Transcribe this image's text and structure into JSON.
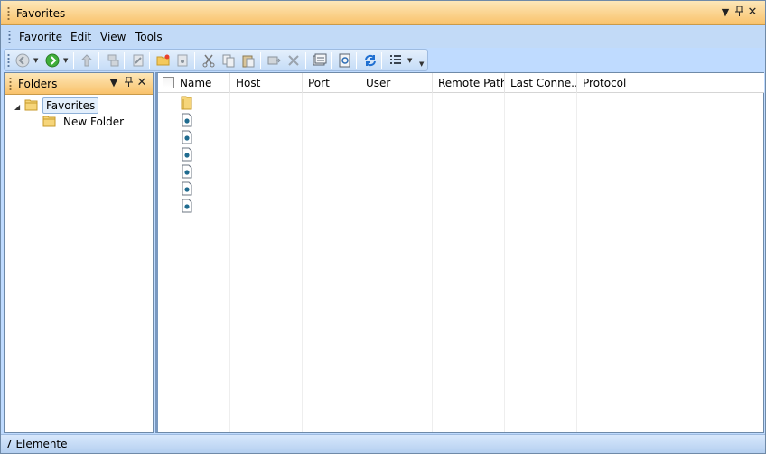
{
  "window": {
    "title": "Favorites"
  },
  "menu": {
    "items": [
      {
        "label": "Favorite",
        "accel": "F",
        "rest": "avorite"
      },
      {
        "label": "Edit",
        "accel": "E",
        "rest": "dit"
      },
      {
        "label": "View",
        "accel": "V",
        "rest": "iew"
      },
      {
        "label": "Tools",
        "accel": "T",
        "rest": "ools"
      }
    ]
  },
  "toolbar": {
    "icons": [
      "back-icon",
      "forward-icon",
      "up-folder-icon",
      "connect-icon",
      "edit-icon",
      "new-folder-icon",
      "new-favorite-icon",
      "cut-icon",
      "copy-icon",
      "paste-icon",
      "move-icon",
      "delete-icon",
      "properties-icon",
      "preview-icon",
      "refresh-icon",
      "columns-icon"
    ]
  },
  "folders": {
    "title": "Folders",
    "tree": [
      {
        "label": "Favorites",
        "selected": true
      },
      {
        "label": "New Folder",
        "selected": false
      }
    ]
  },
  "list": {
    "columns": [
      "Name",
      "Host",
      "Port",
      "User",
      "Remote Path",
      "Last Conne...",
      "Protocol"
    ],
    "rows": [
      {
        "type": "folder"
      },
      {
        "type": "favorite"
      },
      {
        "type": "favorite"
      },
      {
        "type": "favorite"
      },
      {
        "type": "favorite"
      },
      {
        "type": "favorite"
      },
      {
        "type": "favorite"
      }
    ]
  },
  "status": {
    "text": "7 Elemente"
  },
  "colors": {
    "title_gradient_top": "#fde7b8",
    "title_gradient_bottom": "#f9c26b",
    "chrome_blue": "#bfdbff"
  }
}
